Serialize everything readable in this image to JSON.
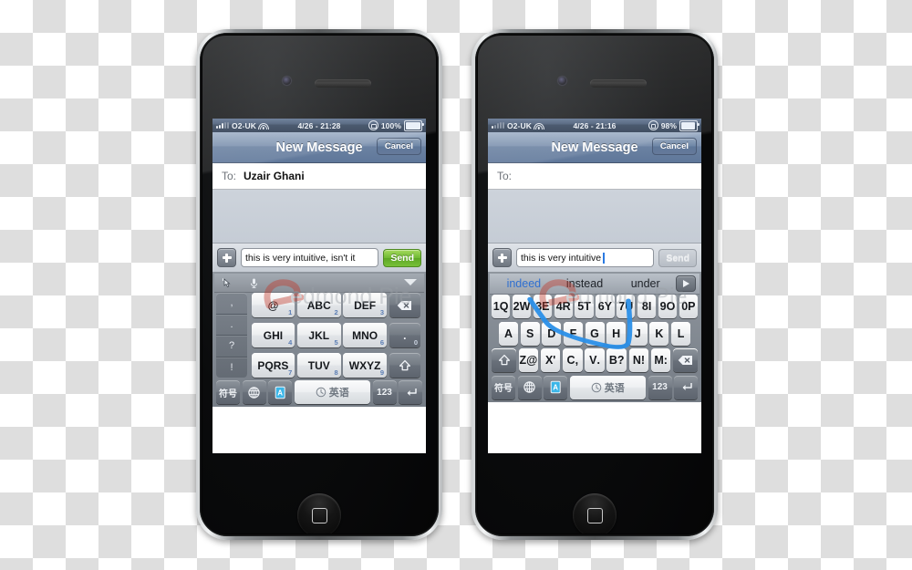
{
  "scene": {
    "background": "transparency-checkerboard",
    "watermark": "Redmond Pie"
  },
  "phones": [
    {
      "id": "left",
      "status_bar": {
        "carrier": "O2-UK",
        "time": "4/26 - 21:28",
        "battery": "100%",
        "signal_bars": 3,
        "wifi": true,
        "rotation_lock": true
      },
      "nav": {
        "title": "New Message",
        "cancel": "Cancel"
      },
      "to_field": {
        "label": "To:",
        "value": "Uzair Ghani"
      },
      "compose": {
        "plus": "+",
        "text": "this is very intuitive, isn't it",
        "placeholder": "",
        "send_label": "Send",
        "send_enabled": true,
        "caret": false
      },
      "ime_toolbar": {
        "handwriting": "handwriting-icon",
        "mic": "microphone-icon",
        "collapse": "chevron-down-icon"
      },
      "keyboard": {
        "type": "t9-keypad",
        "punctuation": [
          ",",
          ".",
          "?",
          "!"
        ],
        "rows": [
          [
            {
              "label": "@",
              "num": "1",
              "style": "light"
            },
            {
              "label": "ABC",
              "num": "2",
              "style": "light"
            },
            {
              "label": "DEF",
              "num": "3",
              "style": "light"
            },
            {
              "label": "",
              "num": "",
              "style": "dark",
              "icon": "backspace-icon"
            }
          ],
          [
            {
              "label": "GHI",
              "num": "4",
              "style": "light"
            },
            {
              "label": "JKL",
              "num": "5",
              "style": "light"
            },
            {
              "label": "MNO",
              "num": "6",
              "style": "light"
            },
            {
              "label": ".",
              "num": "0",
              "style": "dark"
            }
          ],
          [
            {
              "label": "PQRS",
              "num": "7",
              "style": "light"
            },
            {
              "label": "TUV",
              "num": "8",
              "style": "light"
            },
            {
              "label": "WXYZ",
              "num": "9",
              "style": "light"
            },
            {
              "label": "",
              "num": "",
              "style": "dark",
              "icon": "shift-icon"
            }
          ]
        ],
        "bottom_bar": [
          {
            "label": "符号",
            "name": "symbols-key"
          },
          {
            "label": "",
            "name": "globe-icon"
          },
          {
            "label": "",
            "name": "contacts-icon"
          },
          {
            "label": "英语",
            "name": "space-key",
            "icon": "clock-icon"
          },
          {
            "label": "123",
            "name": "numeric-key"
          },
          {
            "label": "",
            "name": "return-icon"
          }
        ]
      }
    },
    {
      "id": "right",
      "status_bar": {
        "carrier": "O2-UK",
        "time": "4/26 - 21:16",
        "battery": "98%",
        "signal_bars": 1,
        "wifi": true,
        "rotation_lock": true
      },
      "nav": {
        "title": "New Message",
        "cancel": "Cancel"
      },
      "to_field": {
        "label": "To:",
        "value": ""
      },
      "compose": {
        "plus": "+",
        "text": "this is very intuitive",
        "placeholder": "",
        "send_label": "Send",
        "send_enabled": false,
        "caret": true
      },
      "suggestions": {
        "items": [
          "indeed",
          "instead",
          "under"
        ],
        "selected_index": 0,
        "more_arrow": "arrow-right-icon"
      },
      "keyboard": {
        "type": "qwerty",
        "swipe_trace": "E-D-N-I",
        "row1": [
          {
            "label": "Q",
            "top": "1"
          },
          {
            "label": "W",
            "top": "2"
          },
          {
            "label": "E",
            "top": "3"
          },
          {
            "label": "R",
            "top": "4"
          },
          {
            "label": "T",
            "top": "5"
          },
          {
            "label": "Y",
            "top": "6"
          },
          {
            "label": "U",
            "top": "7"
          },
          {
            "label": "I",
            "top": "8"
          },
          {
            "label": "O",
            "top": "9"
          },
          {
            "label": "P",
            "top": "0"
          }
        ],
        "row2": [
          {
            "label": "A"
          },
          {
            "label": "S"
          },
          {
            "label": "D"
          },
          {
            "label": "F"
          },
          {
            "label": "G"
          },
          {
            "label": "H"
          },
          {
            "label": "J"
          },
          {
            "label": "K"
          },
          {
            "label": "L"
          }
        ],
        "row3": [
          {
            "label": "Z",
            "sub": "@"
          },
          {
            "label": "X",
            "sub": "'"
          },
          {
            "label": "C",
            "sub": ","
          },
          {
            "label": "V",
            "sub": "."
          },
          {
            "label": "B",
            "sub": "?"
          },
          {
            "label": "N",
            "sub": "!"
          },
          {
            "label": "M",
            "sub": ":"
          }
        ],
        "shift": "shift-icon",
        "backspace": "backspace-icon",
        "bottom_bar": [
          {
            "label": "符号",
            "name": "symbols-key"
          },
          {
            "label": "",
            "name": "globe-icon"
          },
          {
            "label": "",
            "name": "contacts-icon"
          },
          {
            "label": "英语",
            "name": "space-key",
            "icon": "clock-icon"
          },
          {
            "label": "123",
            "name": "numeric-key"
          },
          {
            "label": "",
            "name": "return-icon"
          }
        ]
      }
    }
  ]
}
